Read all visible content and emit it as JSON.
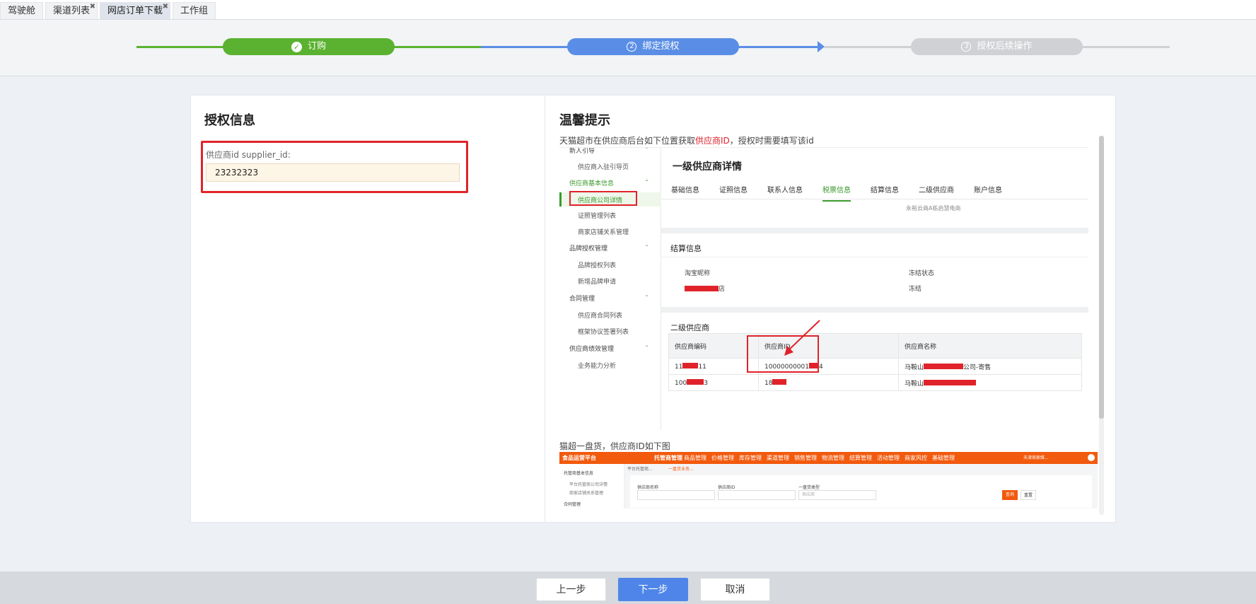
{
  "tabs": [
    {
      "label": "驾驶舱",
      "closable": false,
      "active": false
    },
    {
      "label": "渠道列表",
      "closable": true,
      "active": false
    },
    {
      "label": "网店订单下载",
      "closable": true,
      "active": true
    },
    {
      "label": "工作组",
      "closable": false,
      "active": false
    }
  ],
  "tab_close_glyph": "✖",
  "steps": [
    {
      "label": "订购",
      "index": "✓",
      "state": "done",
      "color": "#5ab230"
    },
    {
      "label": "绑定授权",
      "index": "2",
      "state": "current",
      "color": "#5a8ee6"
    },
    {
      "label": "授权后续操作",
      "index": "3",
      "state": "pending",
      "color": "#cfd1d4"
    }
  ],
  "auth": {
    "title": "授权信息",
    "field_label": "供应商id supplier_id:",
    "field_value": "23232323"
  },
  "tips": {
    "title": "温馨提示",
    "line1_prefix": "天猫超市在供应商后台如下位置获取",
    "line1_highlight": "供应商ID",
    "line1_suffix": "，授权时需要填写该id",
    "line2": "猫超一盘货，供应商ID如下图"
  },
  "shot1": {
    "sidebar": {
      "top_cut": "新人引导",
      "items": [
        {
          "type": "item",
          "label": "供应商入驻引导页"
        },
        {
          "type": "group",
          "label": "供应商基本信息",
          "active": true
        },
        {
          "type": "item",
          "label": "供应商公司详情",
          "active": true
        },
        {
          "type": "item",
          "label": "证照管理列表"
        },
        {
          "type": "item",
          "label": "商家店铺关系管理"
        },
        {
          "type": "group",
          "label": "品牌授权管理"
        },
        {
          "type": "item",
          "label": "品牌授权列表"
        },
        {
          "type": "item",
          "label": "新增品牌申请"
        },
        {
          "type": "group",
          "label": "合同管理"
        },
        {
          "type": "item",
          "label": "供应商合同列表"
        },
        {
          "type": "item",
          "label": "框架协议签署列表"
        },
        {
          "type": "group",
          "label": "供应商绩效管理"
        },
        {
          "type": "item",
          "label": "业务能力分析"
        }
      ]
    },
    "title": "一级供应商详情",
    "tabs": [
      "基础信息",
      "证照信息",
      "联系人信息",
      "税票信息",
      "结算信息",
      "二级供应商",
      "账户信息"
    ],
    "active_tab": "税票信息",
    "gray_line": "永裕云商A栋启慧电商",
    "settlement_title": "结算信息",
    "settlement_labels": [
      "淘宝昵称",
      "冻结状态"
    ],
    "settlement_values": [
      "店",
      "冻结"
    ],
    "secondary_title": "二级供应商",
    "table": {
      "headers": [
        "供应商编码",
        "供应商ID",
        "供应商名称"
      ],
      "rows": [
        [
          "11",
          "11",
          "10000000001",
          "4",
          "马鞍山",
          "公司-寄售"
        ],
        [
          "100",
          "3",
          "18",
          "",
          "马鞍山",
          ""
        ]
      ]
    }
  },
  "shot2": {
    "brand": "食品运营平台",
    "nav": [
      "托管商管理",
      "商品管理",
      "价格管理",
      "库存管理",
      "渠道管理",
      "销售管理",
      "物流管理",
      "结算管理",
      "活动管理",
      "商家风控",
      "基础管理"
    ],
    "user": "天津商家维...",
    "side": [
      "托管商基本信息",
      "平台托管商公司详情",
      "商家店铺关系管理",
      "合同管理"
    ],
    "breadcrumb": [
      "平台托管商...",
      "一盘货业务..."
    ],
    "fields": [
      "供应商名称",
      "供应商ID",
      "一盘货类型"
    ],
    "select_placeholder": "供应商",
    "buttons": [
      "查询",
      "重置"
    ]
  },
  "footer": {
    "prev": "上一步",
    "next": "下一步",
    "cancel": "取消"
  },
  "colors": {
    "done": "#5ab230",
    "current": "#5a8ee6",
    "pending": "#cfd1d4",
    "highlight_red": "#e0232a",
    "primary_button": "#4f85e8",
    "tmall_orange": "#f25a0d"
  }
}
